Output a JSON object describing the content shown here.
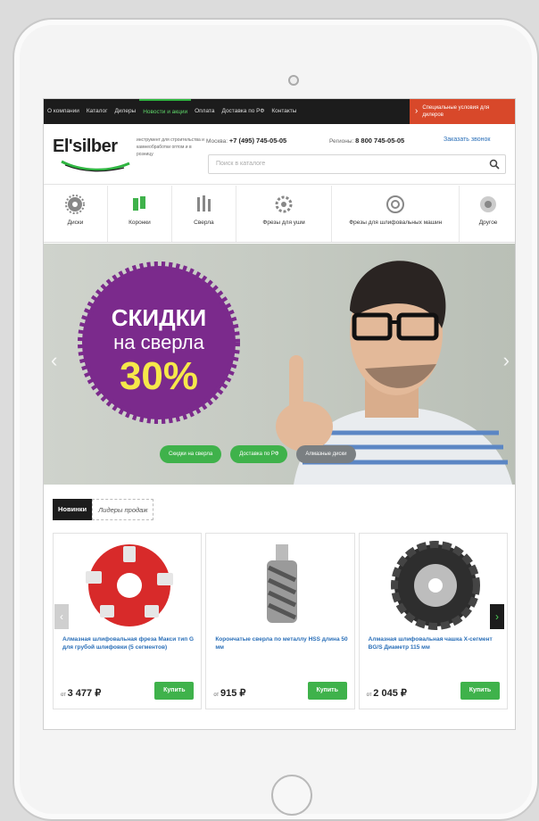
{
  "topnav": {
    "items": [
      "О компании",
      "Каталог",
      "Дилеры",
      "Новости и акции",
      "Оплата",
      "Доставка по РФ",
      "Контакты"
    ],
    "special": "Специальные условия для дилеров"
  },
  "header": {
    "logo": "El'silber",
    "tagline": "инструмент для строительства и камнеобработки оптом и в розницу",
    "phone1_label": "Москва:",
    "phone1": "+7 (495) 745-05-05",
    "phone2_label": "Регионы:",
    "phone2": "8 800 745-05-05",
    "callback": "Заказать звонок",
    "search_placeholder": "Поиск в каталоге"
  },
  "categories": [
    "Диски",
    "Коронки",
    "Сверла",
    "Фрезы для ушм",
    "Фрезы для шлифовальных машин",
    "Другое"
  ],
  "banner": {
    "line1": "СКИДКИ",
    "line2": "на сверла",
    "line3": "30%",
    "pills": [
      "Скидки на сверла",
      "Доставка по РФ",
      "Алмазные диски"
    ]
  },
  "tabs": [
    "Новинки",
    "Лидеры продаж"
  ],
  "products": [
    {
      "name": "Алмазная шлифовальная фреза Макси тип G для грубой шлифовки (5 сегментов)",
      "price_prefix": "от",
      "price": "3 477 ₽",
      "buy": "Купить"
    },
    {
      "name": "Корончатые сверла по металлу HSS длина 50 мм",
      "price_prefix": "от",
      "price": "915 ₽",
      "buy": "Купить"
    },
    {
      "name": "Алмазная шлифовальная чашка Х-сегмент BG/S Диаметр 115 мм",
      "price_prefix": "от",
      "price": "2 045 ₽",
      "buy": "Купить"
    }
  ],
  "colors": {
    "accent": "#3fb24b",
    "dark": "#1c1c1c",
    "special": "#d8482a",
    "badge": "#7b2a8c",
    "badge_text": "#f6e84a"
  }
}
